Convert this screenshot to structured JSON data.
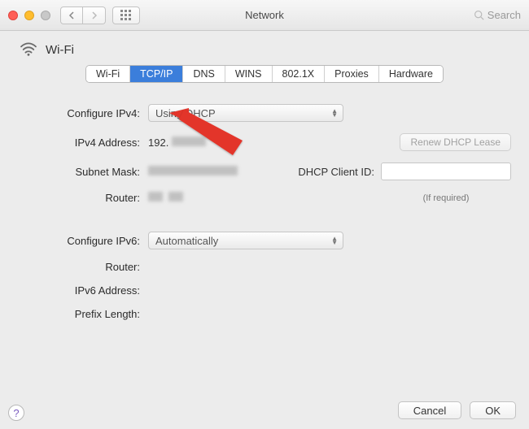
{
  "titlebar": {
    "title": "Network",
    "search_placeholder": "Search"
  },
  "header": {
    "wifi_label": "Wi-Fi"
  },
  "tabs": [
    {
      "label": "Wi-Fi",
      "active": false
    },
    {
      "label": "TCP/IP",
      "active": true
    },
    {
      "label": "DNS",
      "active": false
    },
    {
      "label": "WINS",
      "active": false
    },
    {
      "label": "802.1X",
      "active": false
    },
    {
      "label": "Proxies",
      "active": false
    },
    {
      "label": "Hardware",
      "active": false
    }
  ],
  "ipv4": {
    "configure_label": "Configure IPv4:",
    "configure_value": "Using DHCP",
    "address_label": "IPv4 Address:",
    "address_value": "192.",
    "subnet_label": "Subnet Mask:",
    "router_label": "Router:",
    "renew_label": "Renew DHCP Lease",
    "clientid_label": "DHCP Client ID:",
    "if_required": "(If required)"
  },
  "ipv6": {
    "configure_label": "Configure IPv6:",
    "configure_value": "Automatically",
    "router_label": "Router:",
    "address_label": "IPv6 Address:",
    "prefix_label": "Prefix Length:"
  },
  "footer": {
    "cancel": "Cancel",
    "ok": "OK"
  },
  "help": "?"
}
